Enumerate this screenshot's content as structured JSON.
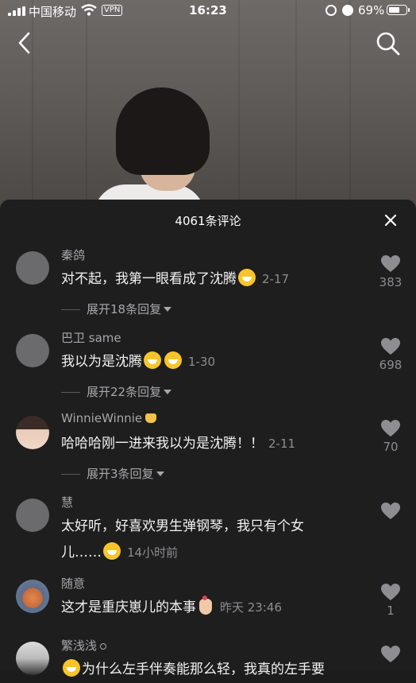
{
  "status_bar": {
    "carrier": "中国移动",
    "vpn_label": "VPN",
    "time": "16:23",
    "battery_percent": "69%",
    "battery_level": 0.69
  },
  "header": {
    "back_icon": "chevron-left-icon",
    "search_icon": "search-icon"
  },
  "comments_panel": {
    "title": "4061条评论",
    "close_icon": "close-icon",
    "comments": [
      {
        "username": "秦鸽",
        "text": "对不起，我第一眼看成了沈腾",
        "emoji": [
          "grin-emoji"
        ],
        "time": "2-17",
        "likes": "383",
        "replies_label": "展开18条回复"
      },
      {
        "username": "巴卫 same",
        "text": "我以为是沈腾",
        "emoji": [
          "laugh-emoji",
          "laugh-emoji"
        ],
        "time": "1-30",
        "likes": "698",
        "replies_label": "展开22条回复"
      },
      {
        "username": "WinnieWinnie",
        "text": "哈哈哈刚一进来我以为是沈腾！！",
        "time": "2-11",
        "likes": "70",
        "replies_label": "展开3条回复"
      },
      {
        "username": "慧",
        "text_line1": "太好听，好喜欢男生弹钢琴，我只有个女",
        "text_line2": "儿……",
        "emoji": [
          "laugh-emoji"
        ],
        "time": "14小时前",
        "likes": ""
      },
      {
        "username": "随意",
        "text": "这才是重庆崽儿的本事",
        "emoji": [
          "finger-heart-emoji"
        ],
        "time": "昨天 23:46",
        "likes": "1"
      },
      {
        "username": "繁浅浅",
        "text": "为什么左手伴奏能那么轻，我真的左手要",
        "likes": ""
      }
    ]
  },
  "colors": {
    "sheet_bg": "#1e1e1e",
    "secondary_text": "#a7a7ab",
    "meta_text": "#8d8d92"
  }
}
